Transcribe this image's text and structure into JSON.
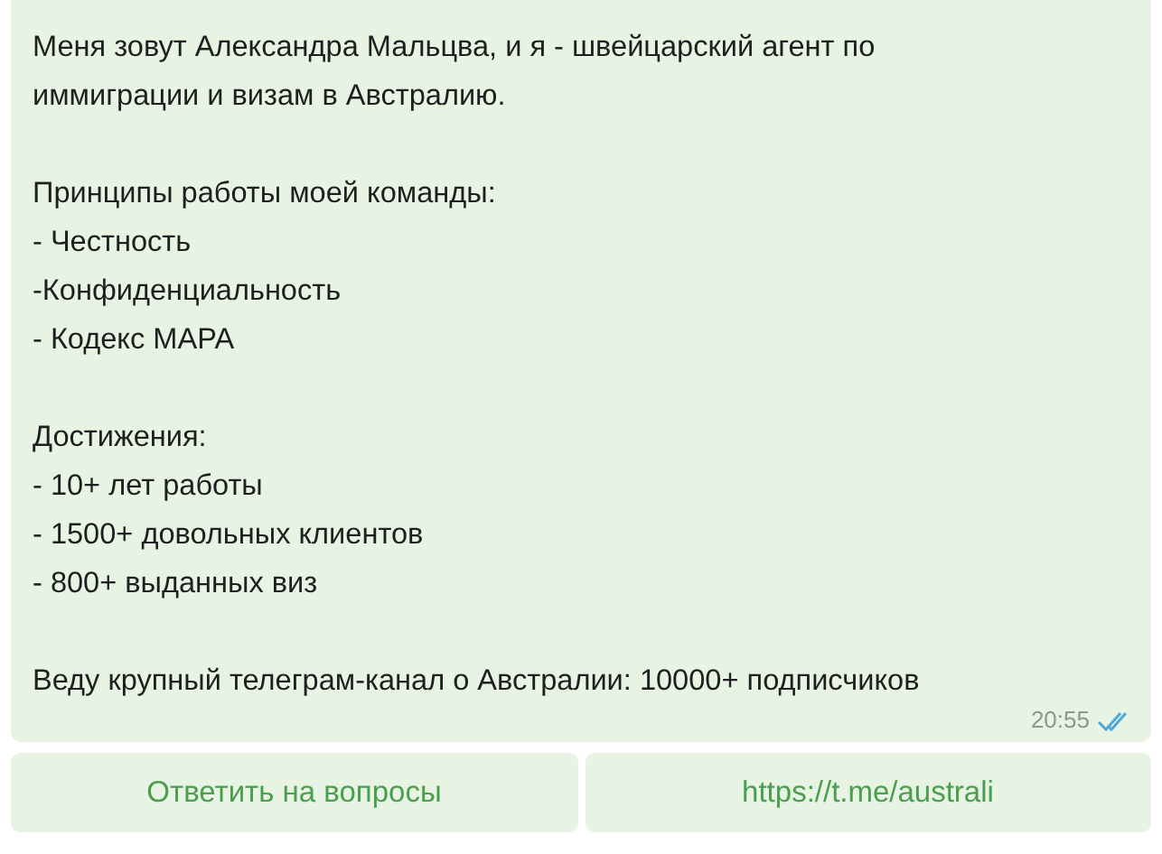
{
  "message": {
    "blocks": [
      {
        "lines": [
          "Меня зовут Александра Мальцва, и я - швейцарский агент по иммиграции и визам в Австралию."
        ]
      },
      {
        "lines": [
          "Принципы работы моей команды:",
          "- Честность",
          "-Конфиденциальность",
          "- Кодекс MAPA"
        ]
      },
      {
        "lines": [
          "Достижения:",
          "- 10+ лет работы",
          "- 1500+ довольных клиентов",
          "- 800+ выданных виз"
        ]
      },
      {
        "lines": [
          "Веду крупный телеграм-канал о Австралии: 10000+ подписчиков"
        ]
      }
    ],
    "time": "20:55",
    "read": true
  },
  "buttons": [
    {
      "label": "Ответить на вопросы"
    },
    {
      "label": "https://t.me/australi"
    }
  ]
}
